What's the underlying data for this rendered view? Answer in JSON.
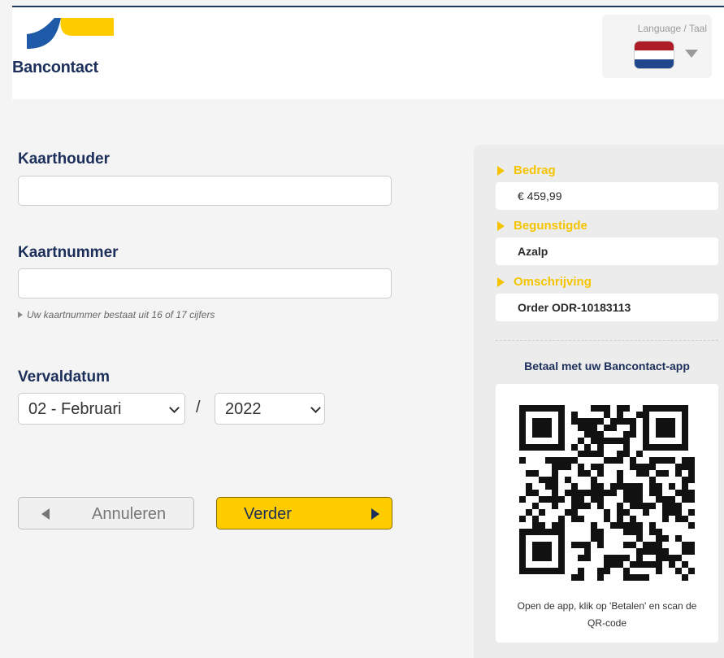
{
  "header": {
    "brand": "Bancontact",
    "language_label": "Language / Taal",
    "flag_colors": [
      "#ae1c28",
      "#ffffff",
      "#21468b"
    ]
  },
  "form": {
    "cardholder_label": "Kaarthouder",
    "cardholder_value": "",
    "cardnumber_label": "Kaartnummer",
    "cardnumber_value": "",
    "cardnumber_hint": "Uw kaartnummer bestaat uit 16 of 17 cijfers",
    "expiry_label": "Vervaldatum",
    "expiry_month": "02 - Februari",
    "expiry_separator": "/",
    "expiry_year": "2022",
    "cancel_label": "Annuleren",
    "next_label": "Verder"
  },
  "summary": {
    "amount_label": "Bedrag",
    "amount_value": "€ 459,99",
    "beneficiary_label": "Begunstigde",
    "beneficiary_value": "Azalp",
    "description_label": "Omschrijving",
    "description_value": "Order ODR-10183113",
    "app_title": "Betaal met uw Bancontact-app",
    "qr_caption": "Open de app, klik op 'Betalen' en scan de QR-code"
  },
  "colors": {
    "brand_navy": "#1c2f5a",
    "brand_yellow": "#ffcc00",
    "brand_blue": "#1e5aa8"
  }
}
